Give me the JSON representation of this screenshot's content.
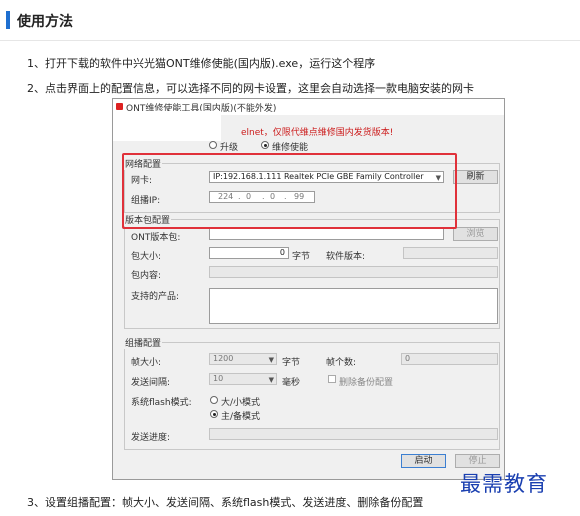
{
  "header": {
    "title": "使用方法"
  },
  "steps": {
    "step1": "1、打开下载的软件中兴光猫ONT维修使能(国内版).exe，运行这个程序",
    "step2": "2、点击界面上的配置信息，可以选择不同的网卡设置，这里会自动选择一款电脑安装的网卡",
    "step3": "3、设置组播配置：帧大小、发送间隔、系统flash模式、发送进度、删除备份配置"
  },
  "app": {
    "title": "ONT维修使能工具(国内版)(不能外发)",
    "warning": "elnet，仅限代维点维修国内发货版本!",
    "mode_options": [
      "升级",
      "维修使能"
    ],
    "mode_selected": "维修使能",
    "network": {
      "group_title": "网络配置",
      "nic_label": "网卡:",
      "nic_value": "IP:192.168.1.111 Realtek PCIe GBE Family Controller",
      "refresh_label": "刷新",
      "mcast_ip_label": "组播IP:",
      "mcast_ip": [
        "224",
        "0",
        "0",
        "99"
      ]
    },
    "package": {
      "group_title": "版本包配置",
      "ont_pkg_label": "ONT版本包:",
      "browse_label": "浏览",
      "size_label": "包大小:",
      "size_value": "0",
      "size_unit": "字节",
      "sw_version_label": "软件版本:",
      "content_label": "包内容:",
      "products_label": "支持的产品:"
    },
    "multicast": {
      "group_title": "组播配置",
      "frame_size_label": "帧大小:",
      "frame_size_value": "1200",
      "frame_size_unit": "字节",
      "frame_count_label": "帧个数:",
      "frame_count_value": "0",
      "interval_label": "发送间隔:",
      "interval_value": "10",
      "interval_unit": "毫秒",
      "delete_backup_label": "删除备份配置",
      "flash_mode_label": "系统flash模式:",
      "flash_options": [
        "大/小模式",
        "主/备模式"
      ],
      "flash_selected": "主/备模式",
      "progress_label": "发送进度:",
      "progress": 0
    },
    "start_label": "启动",
    "stop_label": "停止"
  },
  "watermark": "最需教育",
  "colors": {
    "accent": "#1f6fd0",
    "highlight": "#e0313a",
    "warning": "#cc1d1d",
    "watermark": "#1a3fb0"
  }
}
